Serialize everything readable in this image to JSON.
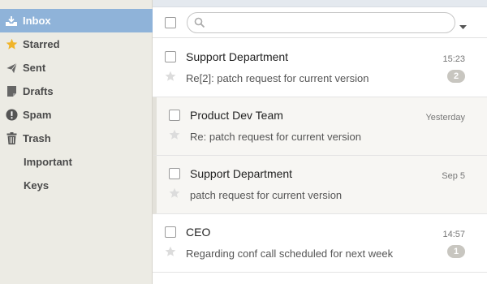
{
  "sidebar": {
    "items": [
      {
        "label": "Inbox",
        "icon": "inbox-icon",
        "active": true
      },
      {
        "label": "Starred",
        "icon": "star-icon"
      },
      {
        "label": "Sent",
        "icon": "paper-plane-icon"
      },
      {
        "label": "Drafts",
        "icon": "draft-icon"
      },
      {
        "label": "Spam",
        "icon": "warning-icon"
      },
      {
        "label": "Trash",
        "icon": "trash-icon"
      },
      {
        "label": "Important",
        "icon": ""
      },
      {
        "label": "Keys",
        "icon": ""
      }
    ]
  },
  "search": {
    "placeholder": "",
    "value": ""
  },
  "messages": [
    {
      "sender": "Support Department",
      "subject": "Re[2]: patch request for current version",
      "time": "15:23",
      "count": "2",
      "read": false
    },
    {
      "sender": "Product Dev Team",
      "subject": "Re: patch request for current version",
      "time": "Yesterday",
      "count": "",
      "read": true
    },
    {
      "sender": "Support Department",
      "subject": "patch request for current version",
      "time": "Sep 5",
      "count": "",
      "read": true
    },
    {
      "sender": "CEO",
      "subject": "Regarding conf call scheduled for next week",
      "time": "14:57",
      "count": "1",
      "read": false
    }
  ],
  "colors": {
    "accent": "#8fb3d9",
    "star": "#f0b429",
    "sidebar_bg": "#ecebe4"
  }
}
